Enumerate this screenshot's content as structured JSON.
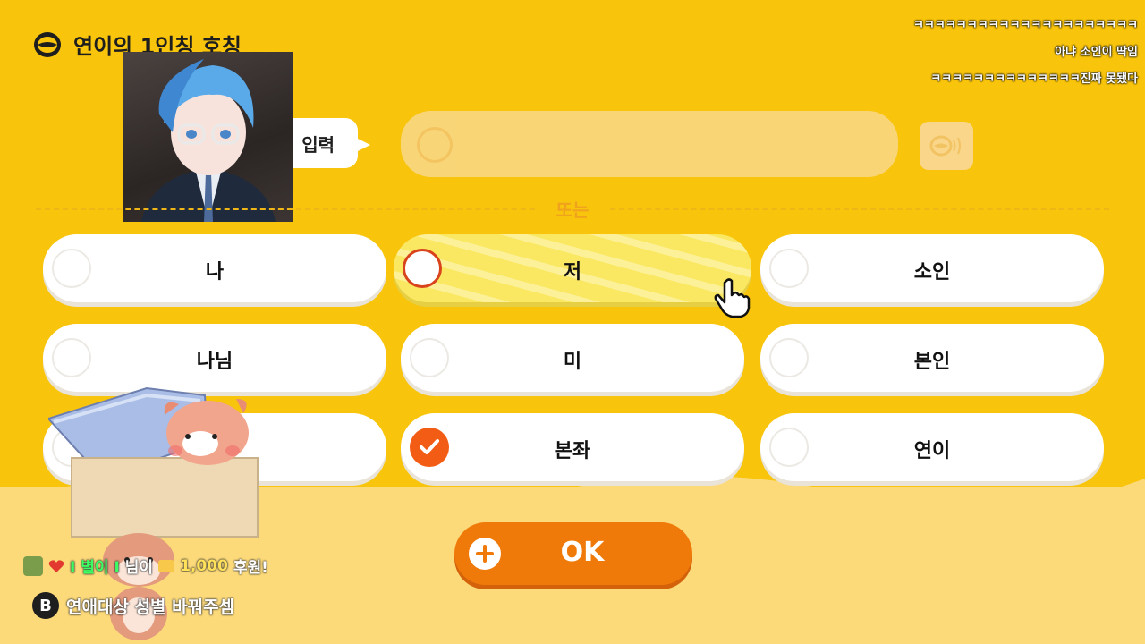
{
  "header": {
    "title": "연이의 1인칭 호칭",
    "logo_icon": "lips-icon"
  },
  "chat": {
    "messages": [
      "ㅋㅋㅋㅋㅋㅋㅋㅋㅋㅋㅋㅋㅋㅋㅋㅋㅋㅋㅋㅋㅋ",
      "아냐 소인이 딱임",
      "ㅋㅋㅋㅋㅋㅋㅋㅋㅋㅋㅋㅋㅋㅋ진짜 못됐다"
    ]
  },
  "input": {
    "label": "입력",
    "value": "",
    "voice_icon": "voice-lips-icon"
  },
  "or_label": "또는",
  "options": [
    {
      "label": "나",
      "state": "default"
    },
    {
      "label": "저",
      "state": "hover"
    },
    {
      "label": "소인",
      "state": "default"
    },
    {
      "label": "나님",
      "state": "default"
    },
    {
      "label": "미",
      "state": "default"
    },
    {
      "label": "본인",
      "state": "default"
    },
    {
      "label": "",
      "state": "default"
    },
    {
      "label": "본좌",
      "state": "checked"
    },
    {
      "label": "연이",
      "state": "default"
    }
  ],
  "ok_button": {
    "label": "OK"
  },
  "donation": {
    "name": "I 별이 I",
    "suffix": "님이",
    "amount": "1,000",
    "action": "후원!"
  },
  "hint": {
    "key": "B",
    "text": "연애대상 성별 바꿔주셈"
  },
  "colors": {
    "background": "#f8c40c",
    "accent": "#f07a09",
    "selected": "#f25c14",
    "hover": "#fae863"
  }
}
